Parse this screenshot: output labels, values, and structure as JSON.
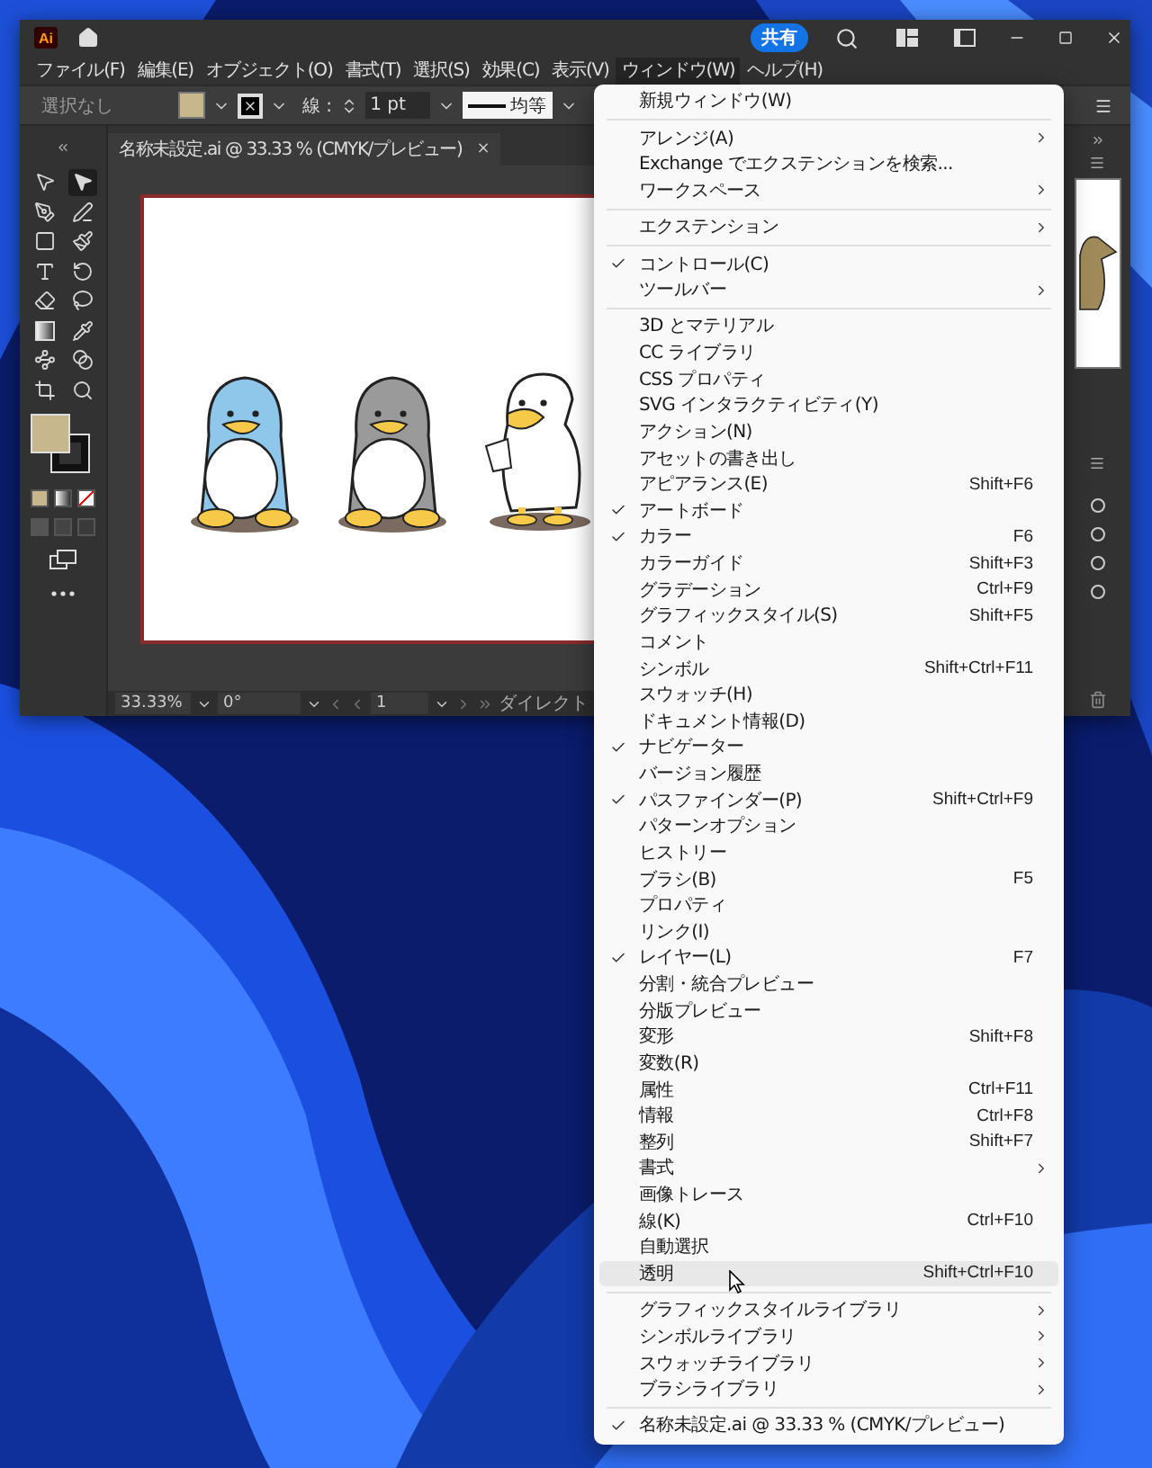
{
  "app": {
    "logo": "Ai",
    "share_button": "共有"
  },
  "menu_bar": [
    {
      "label": "ファイル(F)",
      "selected": false
    },
    {
      "label": "編集(E)",
      "selected": false
    },
    {
      "label": "オブジェクト(O)",
      "selected": false
    },
    {
      "label": "書式(T)",
      "selected": false
    },
    {
      "label": "選択(S)",
      "selected": false
    },
    {
      "label": "効果(C)",
      "selected": false
    },
    {
      "label": "表示(V)",
      "selected": false
    },
    {
      "label": "ウィンドウ(W)",
      "selected": true
    },
    {
      "label": "ヘルプ(H)",
      "selected": false
    }
  ],
  "control_bar": {
    "selection": "選択なし",
    "stroke_label": "線 :",
    "stroke_weight": "1 pt",
    "stroke_profile": "均等"
  },
  "document_tab": {
    "title": "名称未設定.ai @ 33.33 % (CMYK/プレビュー)",
    "close": "×"
  },
  "tools": [
    {
      "kind": "selection",
      "selected": false
    },
    {
      "kind": "direct",
      "selected": true
    },
    {
      "kind": "pen",
      "selected": false
    },
    {
      "kind": "curvature",
      "selected": false
    },
    {
      "kind": "rectangle",
      "selected": false
    },
    {
      "kind": "brush",
      "selected": false
    },
    {
      "kind": "type",
      "selected": false
    },
    {
      "kind": "rotate",
      "selected": false
    },
    {
      "kind": "eraser",
      "selected": false
    },
    {
      "kind": "lasso",
      "selected": false
    },
    {
      "kind": "gradient",
      "selected": false
    },
    {
      "kind": "eyedropper",
      "selected": false
    },
    {
      "kind": "warp",
      "selected": false
    },
    {
      "kind": "blend",
      "selected": false
    },
    {
      "kind": "artboard",
      "selected": false
    },
    {
      "kind": "zoom",
      "selected": false
    }
  ],
  "status_bar": {
    "zoom": "33.33%",
    "rotation": "0°",
    "artboard": "1",
    "tool_name": "ダイレクト"
  },
  "window_menu": [
    {
      "kind": "item",
      "label": "新規ウィンドウ(W)",
      "checked": false,
      "submenu": false,
      "selected": false
    },
    {
      "kind": "separator"
    },
    {
      "kind": "item",
      "label": "アレンジ(A)",
      "checked": false,
      "submenu": true,
      "selected": false
    },
    {
      "kind": "item",
      "label": "Exchange でエクステンションを検索...",
      "checked": false,
      "submenu": false,
      "selected": false
    },
    {
      "kind": "item",
      "label": "ワークスペース",
      "checked": false,
      "submenu": true,
      "selected": false
    },
    {
      "kind": "separator"
    },
    {
      "kind": "item",
      "label": "エクステンション",
      "checked": false,
      "submenu": true,
      "selected": false
    },
    {
      "kind": "separator"
    },
    {
      "kind": "item",
      "label": "コントロール(C)",
      "checked": true,
      "submenu": false,
      "selected": false
    },
    {
      "kind": "item",
      "label": "ツールバー",
      "checked": false,
      "submenu": true,
      "selected": false
    },
    {
      "kind": "separator"
    },
    {
      "kind": "item",
      "label": "3D とマテリアル",
      "checked": false,
      "submenu": false,
      "selected": false
    },
    {
      "kind": "item",
      "label": "CC ライブラリ",
      "checked": false,
      "submenu": false,
      "selected": false
    },
    {
      "kind": "item",
      "label": "CSS プロパティ",
      "checked": false,
      "submenu": false,
      "selected": false
    },
    {
      "kind": "item",
      "label": "SVG インタラクティビティ(Y)",
      "checked": false,
      "submenu": false,
      "selected": false
    },
    {
      "kind": "item",
      "label": "アクション(N)",
      "checked": false,
      "submenu": false,
      "selected": false
    },
    {
      "kind": "item",
      "label": "アセットの書き出し",
      "checked": false,
      "submenu": false,
      "selected": false
    },
    {
      "kind": "item",
      "label": "アピアランス(E)",
      "shortcut": "Shift+F6",
      "checked": false,
      "submenu": false,
      "selected": false
    },
    {
      "kind": "item",
      "label": "アートボード",
      "checked": true,
      "submenu": false,
      "selected": false
    },
    {
      "kind": "item",
      "label": "カラー",
      "shortcut": "F6",
      "checked": true,
      "submenu": false,
      "selected": false
    },
    {
      "kind": "item",
      "label": "カラーガイド",
      "shortcut": "Shift+F3",
      "checked": false,
      "submenu": false,
      "selected": false
    },
    {
      "kind": "item",
      "label": "グラデーション",
      "shortcut": "Ctrl+F9",
      "checked": false,
      "submenu": false,
      "selected": false
    },
    {
      "kind": "item",
      "label": "グラフィックスタイル(S)",
      "shortcut": "Shift+F5",
      "checked": false,
      "submenu": false,
      "selected": false
    },
    {
      "kind": "item",
      "label": "コメント",
      "checked": false,
      "submenu": false,
      "selected": false
    },
    {
      "kind": "item",
      "label": "シンボル",
      "shortcut": "Shift+Ctrl+F11",
      "checked": false,
      "submenu": false,
      "selected": false
    },
    {
      "kind": "item",
      "label": "スウォッチ(H)",
      "checked": false,
      "submenu": false,
      "selected": false
    },
    {
      "kind": "item",
      "label": "ドキュメント情報(D)",
      "checked": false,
      "submenu": false,
      "selected": false
    },
    {
      "kind": "item",
      "label": "ナビゲーター",
      "checked": true,
      "submenu": false,
      "selected": false
    },
    {
      "kind": "item",
      "label": "バージョン履歴",
      "checked": false,
      "submenu": false,
      "selected": false
    },
    {
      "kind": "item",
      "label": "パスファインダー(P)",
      "shortcut": "Shift+Ctrl+F9",
      "checked": true,
      "submenu": false,
      "selected": false
    },
    {
      "kind": "item",
      "label": "パターンオプション",
      "checked": false,
      "submenu": false,
      "selected": false
    },
    {
      "kind": "item",
      "label": "ヒストリー",
      "checked": false,
      "submenu": false,
      "selected": false
    },
    {
      "kind": "item",
      "label": "ブラシ(B)",
      "shortcut": "F5",
      "checked": false,
      "submenu": false,
      "selected": false
    },
    {
      "kind": "item",
      "label": "プロパティ",
      "checked": false,
      "submenu": false,
      "selected": false
    },
    {
      "kind": "item",
      "label": "リンク(I)",
      "checked": false,
      "submenu": false,
      "selected": false
    },
    {
      "kind": "item",
      "label": "レイヤー(L)",
      "shortcut": "F7",
      "checked": true,
      "submenu": false,
      "selected": false
    },
    {
      "kind": "item",
      "label": "分割・統合プレビュー",
      "checked": false,
      "submenu": false,
      "selected": false
    },
    {
      "kind": "item",
      "label": "分版プレビュー",
      "checked": false,
      "submenu": false,
      "selected": false
    },
    {
      "kind": "item",
      "label": "変形",
      "shortcut": "Shift+F8",
      "checked": false,
      "submenu": false,
      "selected": false
    },
    {
      "kind": "item",
      "label": "変数(R)",
      "checked": false,
      "submenu": false,
      "selected": false
    },
    {
      "kind": "item",
      "label": "属性",
      "shortcut": "Ctrl+F11",
      "checked": false,
      "submenu": false,
      "selected": false
    },
    {
      "kind": "item",
      "label": "情報",
      "shortcut": "Ctrl+F8",
      "checked": false,
      "submenu": false,
      "selected": false
    },
    {
      "kind": "item",
      "label": "整列",
      "shortcut": "Shift+F7",
      "checked": false,
      "submenu": false,
      "selected": false
    },
    {
      "kind": "item",
      "label": "書式",
      "checked": false,
      "submenu": true,
      "selected": false
    },
    {
      "kind": "item",
      "label": "画像トレース",
      "checked": false,
      "submenu": false,
      "selected": false
    },
    {
      "kind": "item",
      "label": "線(K)",
      "shortcut": "Ctrl+F10",
      "checked": false,
      "submenu": false,
      "selected": false
    },
    {
      "kind": "item",
      "label": "自動選択",
      "checked": false,
      "submenu": false,
      "selected": false
    },
    {
      "kind": "item",
      "label": "透明",
      "shortcut": "Shift+Ctrl+F10",
      "checked": false,
      "submenu": false,
      "selected": true
    },
    {
      "kind": "separator"
    },
    {
      "kind": "item",
      "label": "グラフィックスタイルライブラリ",
      "checked": false,
      "submenu": true,
      "selected": false
    },
    {
      "kind": "item",
      "label": "シンボルライブラリ",
      "checked": false,
      "submenu": true,
      "selected": false
    },
    {
      "kind": "item",
      "label": "スウォッチライブラリ",
      "checked": false,
      "submenu": true,
      "selected": false
    },
    {
      "kind": "item",
      "label": "ブラシライブラリ",
      "checked": false,
      "submenu": true,
      "selected": false
    },
    {
      "kind": "separator"
    },
    {
      "kind": "item",
      "label": "名称未設定.ai @ 33.33 % (CMYK/プレビュー)",
      "checked": true,
      "submenu": false,
      "selected": false
    }
  ]
}
